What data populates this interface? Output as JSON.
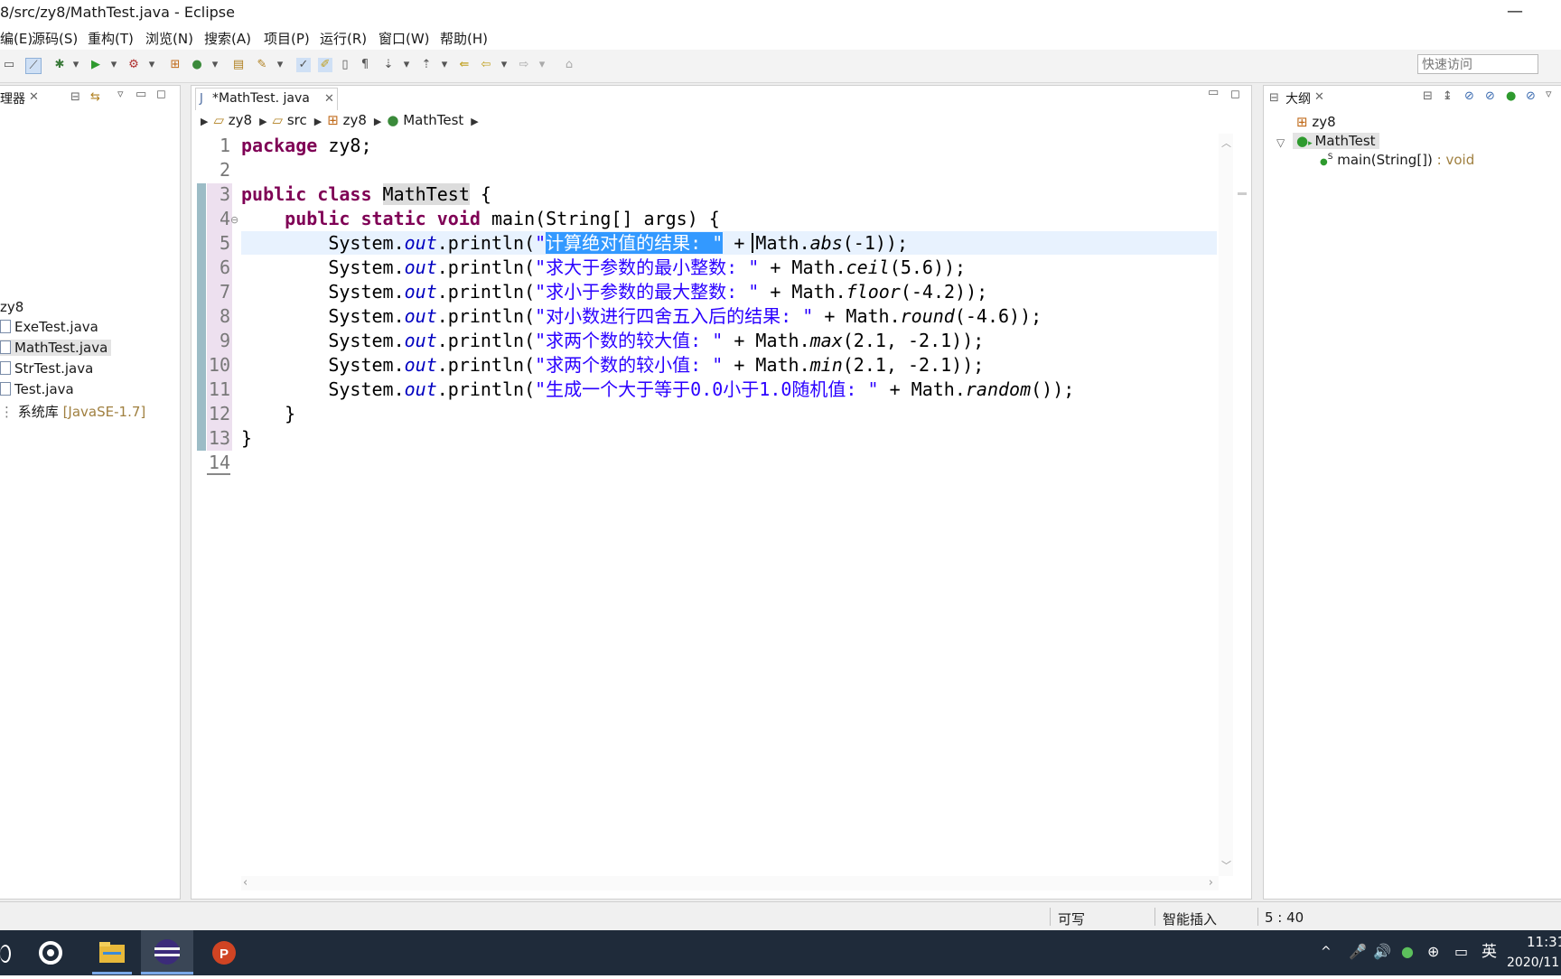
{
  "window": {
    "title": "8/src/zy8/MathTest.java  -  Eclipse",
    "minimize_glyph": "—"
  },
  "menu": {
    "items": [
      "编(E)",
      "源码(S)",
      "重构(T)",
      "浏览(N)",
      "搜索(A)",
      "项目(P)",
      "运行(R)",
      "窗口(W)",
      "帮助(H)"
    ]
  },
  "toolbar": {
    "quick_access_placeholder": "快速访问"
  },
  "left_panel": {
    "tab_label": "理器",
    "project": "zy8",
    "files": [
      "ExeTest.java",
      "MathTest.java",
      "StrTest.java",
      "Test.java"
    ],
    "selected_file": "MathTest.java",
    "library_label": "系统库",
    "library_version": "[JavaSE-1.7]"
  },
  "editor": {
    "tab_label": "*MathTest. java",
    "breadcrumb": [
      "zy8",
      "src",
      "zy8",
      "MathTest"
    ],
    "line_numbers": [
      "1",
      "2",
      "3",
      "4",
      "5",
      "6",
      "7",
      "8",
      "9",
      "10",
      "11",
      "12",
      "13",
      "14"
    ],
    "code": {
      "l1": {
        "kw": "package",
        "rest": " zy8;"
      },
      "l3": {
        "kw": "public class",
        "name": "MathTest",
        "rest": " {"
      },
      "l4": {
        "indent": "    ",
        "kw": "public static void",
        "rest": " main(String[] args) {"
      },
      "l5": {
        "pre": "        System.",
        "fld": "out",
        "mid": ".println(",
        "str_a": "\"",
        "str_sel": "计算绝对值的结果: \"",
        "post_a": " + Math.",
        "fn": "abs",
        "post_b": "(-1));"
      },
      "l6": {
        "pre": "        System.",
        "fld": "out",
        "mid": ".println(",
        "str": "\"求大于参数的最小整数: \"",
        "post_a": " + Math.",
        "fn": "ceil",
        "post_b": "(5.6));"
      },
      "l7": {
        "pre": "        System.",
        "fld": "out",
        "mid": ".println(",
        "str": "\"求小于参数的最大整数: \"",
        "post_a": " + Math.",
        "fn": "floor",
        "post_b": "(-4.2));"
      },
      "l8": {
        "pre": "        System.",
        "fld": "out",
        "mid": ".println(",
        "str": "\"对小数进行四舍五入后的结果: \"",
        "post_a": " + Math.",
        "fn": "round",
        "post_b": "(-4.6));"
      },
      "l9": {
        "pre": "        System.",
        "fld": "out",
        "mid": ".println(",
        "str": "\"求两个数的较大值: \"",
        "post_a": " + Math.",
        "fn": "max",
        "post_b": "(2.1, -2.1));"
      },
      "l10": {
        "pre": "        System.",
        "fld": "out",
        "mid": ".println(",
        "str": "\"求两个数的较小值: \"",
        "post_a": " + Math.",
        "fn": "min",
        "post_b": "(2.1, -2.1));"
      },
      "l11": {
        "pre": "        System.",
        "fld": "out",
        "mid": ".println(",
        "str": "\"生成一个大于等于0.0小于1.0随机值: \"",
        "post_a": " + Math.",
        "fn": "random",
        "post_b": "());"
      },
      "l12": {
        "text": "    }"
      },
      "l13": {
        "text": "}"
      }
    }
  },
  "outline": {
    "tab_label": "大纲",
    "package": "zy8",
    "class_name": "MathTest",
    "method_name": "main(String[])",
    "method_return": " : void",
    "static_marker": "S"
  },
  "status": {
    "writable": "可写",
    "insert_mode": "智能插入",
    "position": "5 :  40"
  },
  "taskbar": {
    "time": "11:31",
    "date": "2020/11",
    "ime": "英",
    "tray_up": "^"
  },
  "colors": {
    "keyword": "#7f0055",
    "string": "#2a00ff",
    "field": "#0000c0",
    "selection": "#3399ff",
    "taskbar": "#1f2b3a"
  }
}
